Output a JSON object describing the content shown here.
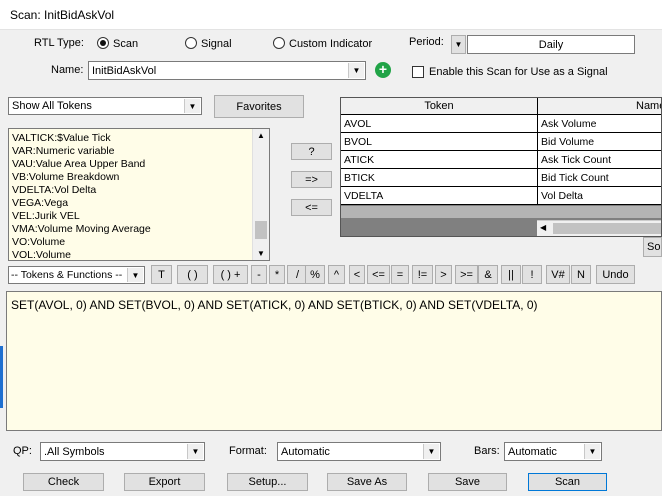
{
  "window": {
    "title": "Scan: InitBidAskVol"
  },
  "header": {
    "rtl_type_label": "RTL Type:",
    "rtl_options": [
      "Scan",
      "Signal",
      "Custom Indicator"
    ],
    "rtl_selected": "Scan",
    "period_label": "Period:",
    "period_value": "Daily",
    "name_label": "Name:",
    "name_value": "InitBidAskVol",
    "enable_label": "Enable this Scan for Use as a Signal",
    "enable_checked": false
  },
  "tokens_panel": {
    "filter_value": "Show All Tokens",
    "favorites_label": "Favorites",
    "list": [
      "VALTICK:$Value Tick",
      "VAR:Numeric variable",
      "VAU:Value Area Upper Band",
      "VB:Volume Breakdown",
      "VDELTA:Vol Delta",
      "VEGA:Vega",
      "VEL:Jurik VEL",
      "VMA:Volume Moving Average",
      "VO:Volume",
      "VOL:Volume"
    ],
    "help_label": "?",
    "add_label": "=>",
    "remove_label": "<="
  },
  "token_grid": {
    "columns": [
      "Token",
      "Name"
    ],
    "rows": [
      {
        "token": "AVOL",
        "name": "Ask Volume"
      },
      {
        "token": "BVOL",
        "name": "Bid Volume"
      },
      {
        "token": "ATICK",
        "name": "Ask Tick Count"
      },
      {
        "token": "BTICK",
        "name": "Bid Tick Count"
      },
      {
        "token": "VDELTA",
        "name": "Vol Delta"
      }
    ],
    "partial_button": "Sor"
  },
  "operator_bar": {
    "category_value": "-- Tokens & Functions --",
    "buttons": [
      "T",
      "( )",
      "( ) +",
      "-",
      "*",
      "/",
      "%",
      "^",
      "<",
      "<=",
      "=",
      "!=",
      ">",
      ">=",
      "&",
      "||",
      "!",
      "V#",
      "N",
      "Undo"
    ]
  },
  "editor": {
    "text": "SET(AVOL, 0) AND SET(BVOL, 0) AND SET(ATICK, 0) AND SET(BTICK, 0) AND SET(VDELTA, 0)"
  },
  "footer": {
    "qp_label": "QP:",
    "qp_value": ".All Symbols",
    "format_label": "Format:",
    "format_value": "Automatic",
    "bars_label": "Bars:",
    "bars_value": "Automatic",
    "check_label": "Check",
    "export_label": "Export",
    "setup_label": "Setup...",
    "saveas_label": "Save As",
    "save_label": "Save",
    "scan_label": "Scan"
  }
}
